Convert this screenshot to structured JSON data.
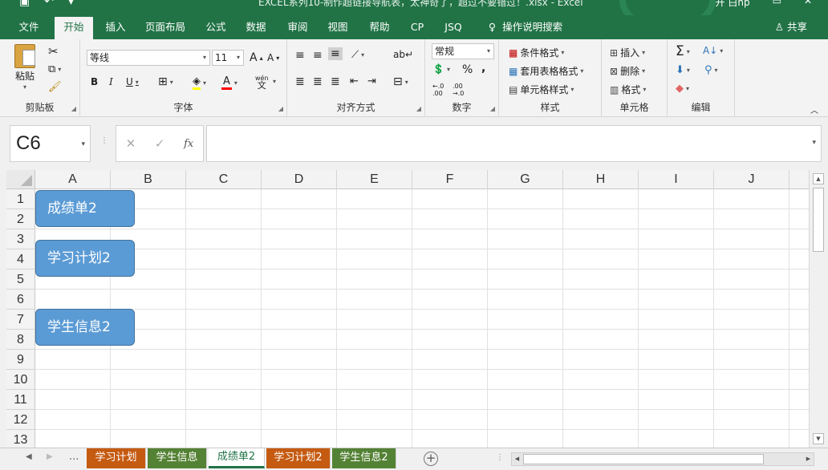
{
  "window": {
    "title": "EXCEL系列10-制作超链接导航表，太神奇了，超过不要错过！.xlsx  -  Excel",
    "quick_access": [
      "save-icon",
      "undo-icon",
      "customize-icon"
    ],
    "user": "开 白hp"
  },
  "ribbon_tabs": [
    "文件",
    "开始",
    "插入",
    "页面布局",
    "公式",
    "数据",
    "审阅",
    "视图",
    "帮助",
    "CP",
    "JSQ"
  ],
  "active_tab": "开始",
  "tell_me": "操作说明搜索",
  "share_label": "共享",
  "groups": {
    "clipboard": {
      "label": "剪贴板",
      "paste": "粘贴"
    },
    "font": {
      "label": "字体",
      "font_name": "等线",
      "font_size": "11",
      "bold": "B",
      "italic": "I",
      "underline": "U",
      "grow": "A",
      "shrink": "A",
      "font_color": "A",
      "wen": "wén",
      "wen2": "文"
    },
    "alignment": {
      "label": "对齐方式"
    },
    "number": {
      "label": "数字",
      "format": "常规",
      "percent": "%",
      "comma": ",",
      "inc_decimal": "←.0 .00",
      "dec_decimal": ".00 →.0"
    },
    "styles": {
      "label": "样式",
      "conditional": "条件格式",
      "table": "套用表格格式",
      "cell": "单元格样式"
    },
    "cells": {
      "label": "单元格",
      "insert": "插入",
      "delete": "删除",
      "format": "格式"
    },
    "editing": {
      "label": "编辑"
    }
  },
  "formula_bar": {
    "name_box": "C6",
    "formula": "",
    "cancel": "✕",
    "enter": "✓",
    "fx": "fx"
  },
  "sheet": {
    "columns": [
      "A",
      "B",
      "C",
      "D",
      "E",
      "F",
      "G",
      "H",
      "I",
      "J"
    ],
    "rows": [
      "1",
      "2",
      "3",
      "4",
      "5",
      "6",
      "7",
      "8",
      "9",
      "10",
      "11",
      "12",
      "13"
    ],
    "shapes": [
      "成绩单2",
      "学习计划2",
      "学生信息2"
    ],
    "shape_color": "#5b9bd5"
  },
  "sheet_tabs": {
    "overflow": "...",
    "tabs": [
      {
        "name": "学习计划",
        "color": "#c55a11"
      },
      {
        "name": "学生信息",
        "color": "#548235"
      },
      {
        "name": "成绩单2",
        "color": "#ffffff"
      },
      {
        "name": "学习计划2",
        "color": "#c55a11"
      },
      {
        "name": "学生信息2",
        "color": "#548235"
      }
    ],
    "active": "成绩单2"
  },
  "colors": {
    "excel_green": "#217346",
    "ribbon_bg": "#f3f3f3"
  }
}
